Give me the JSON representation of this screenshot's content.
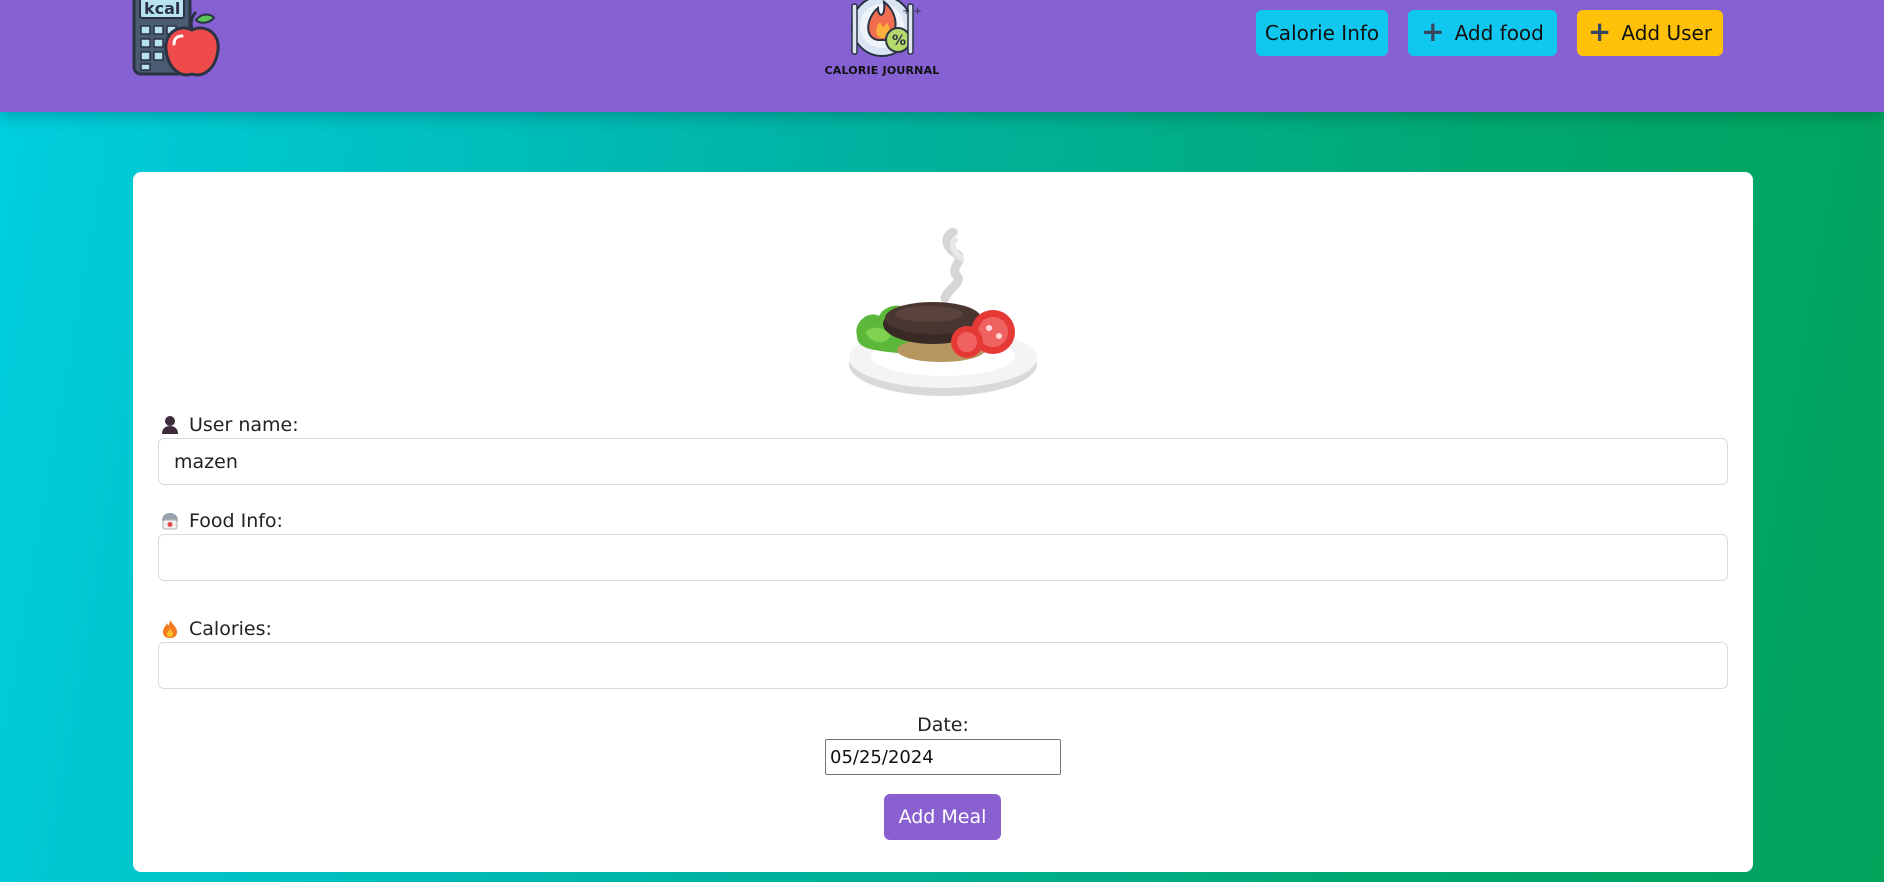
{
  "app": {
    "logo_text": "kcal",
    "brand_text": "CALORIE JOURNAL",
    "brand_color": "#8661d3"
  },
  "nav": {
    "calorie_info": "Calorie Info",
    "add_food": "Add food",
    "add_user": "Add User"
  },
  "form": {
    "username_label": "User name:",
    "username_value": "mazen",
    "food_label": "Food Info:",
    "food_value": "",
    "calories_label": "Calories:",
    "calories_value": "",
    "date_label": "Date:",
    "date_value": "05/25/2024",
    "submit_label": "Add Meal"
  },
  "colors": {
    "nav_cyan": "#10c8ef",
    "nav_yellow": "#ffc107",
    "submit": "#8a5fd0"
  }
}
